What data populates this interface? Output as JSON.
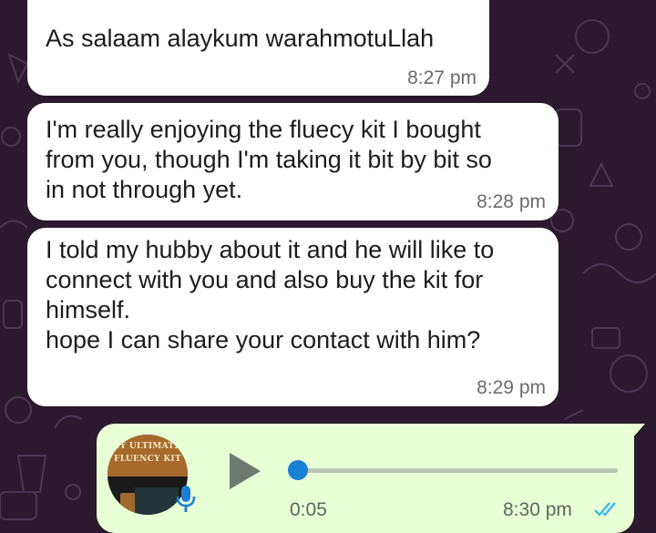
{
  "messages": [
    {
      "text": "As salaam alaykum warahmotuLlah",
      "time": "8:27 pm"
    },
    {
      "text": "I'm really enjoying the fluecy kit I bought\nfrom you, though I'm taking it bit by bit so\nin not through yet.",
      "time": "8:28 pm"
    },
    {
      "text": "I told my hubby about it and he will like to\nconnect with you and also buy the kit for\nhimself.\n hope I can share your contact with him?",
      "time": "8:29 pm"
    }
  ],
  "voice_note": {
    "avatar_text_line1": "MY ULTIMATE",
    "avatar_text_line2": "FLUENCY KIT",
    "duration": "0:05",
    "time": "8:30 pm",
    "progress": 0.0,
    "status": "read",
    "icons": [
      "play-icon",
      "mic-icon",
      "double-check-icon"
    ]
  },
  "colors": {
    "background": "#2b1a2e",
    "incoming_bubble": "#ffffff",
    "outgoing_bubble": "#e8ffd6",
    "read_ticks": "#34b7f1",
    "progress_knob": "#1c7fd6"
  }
}
